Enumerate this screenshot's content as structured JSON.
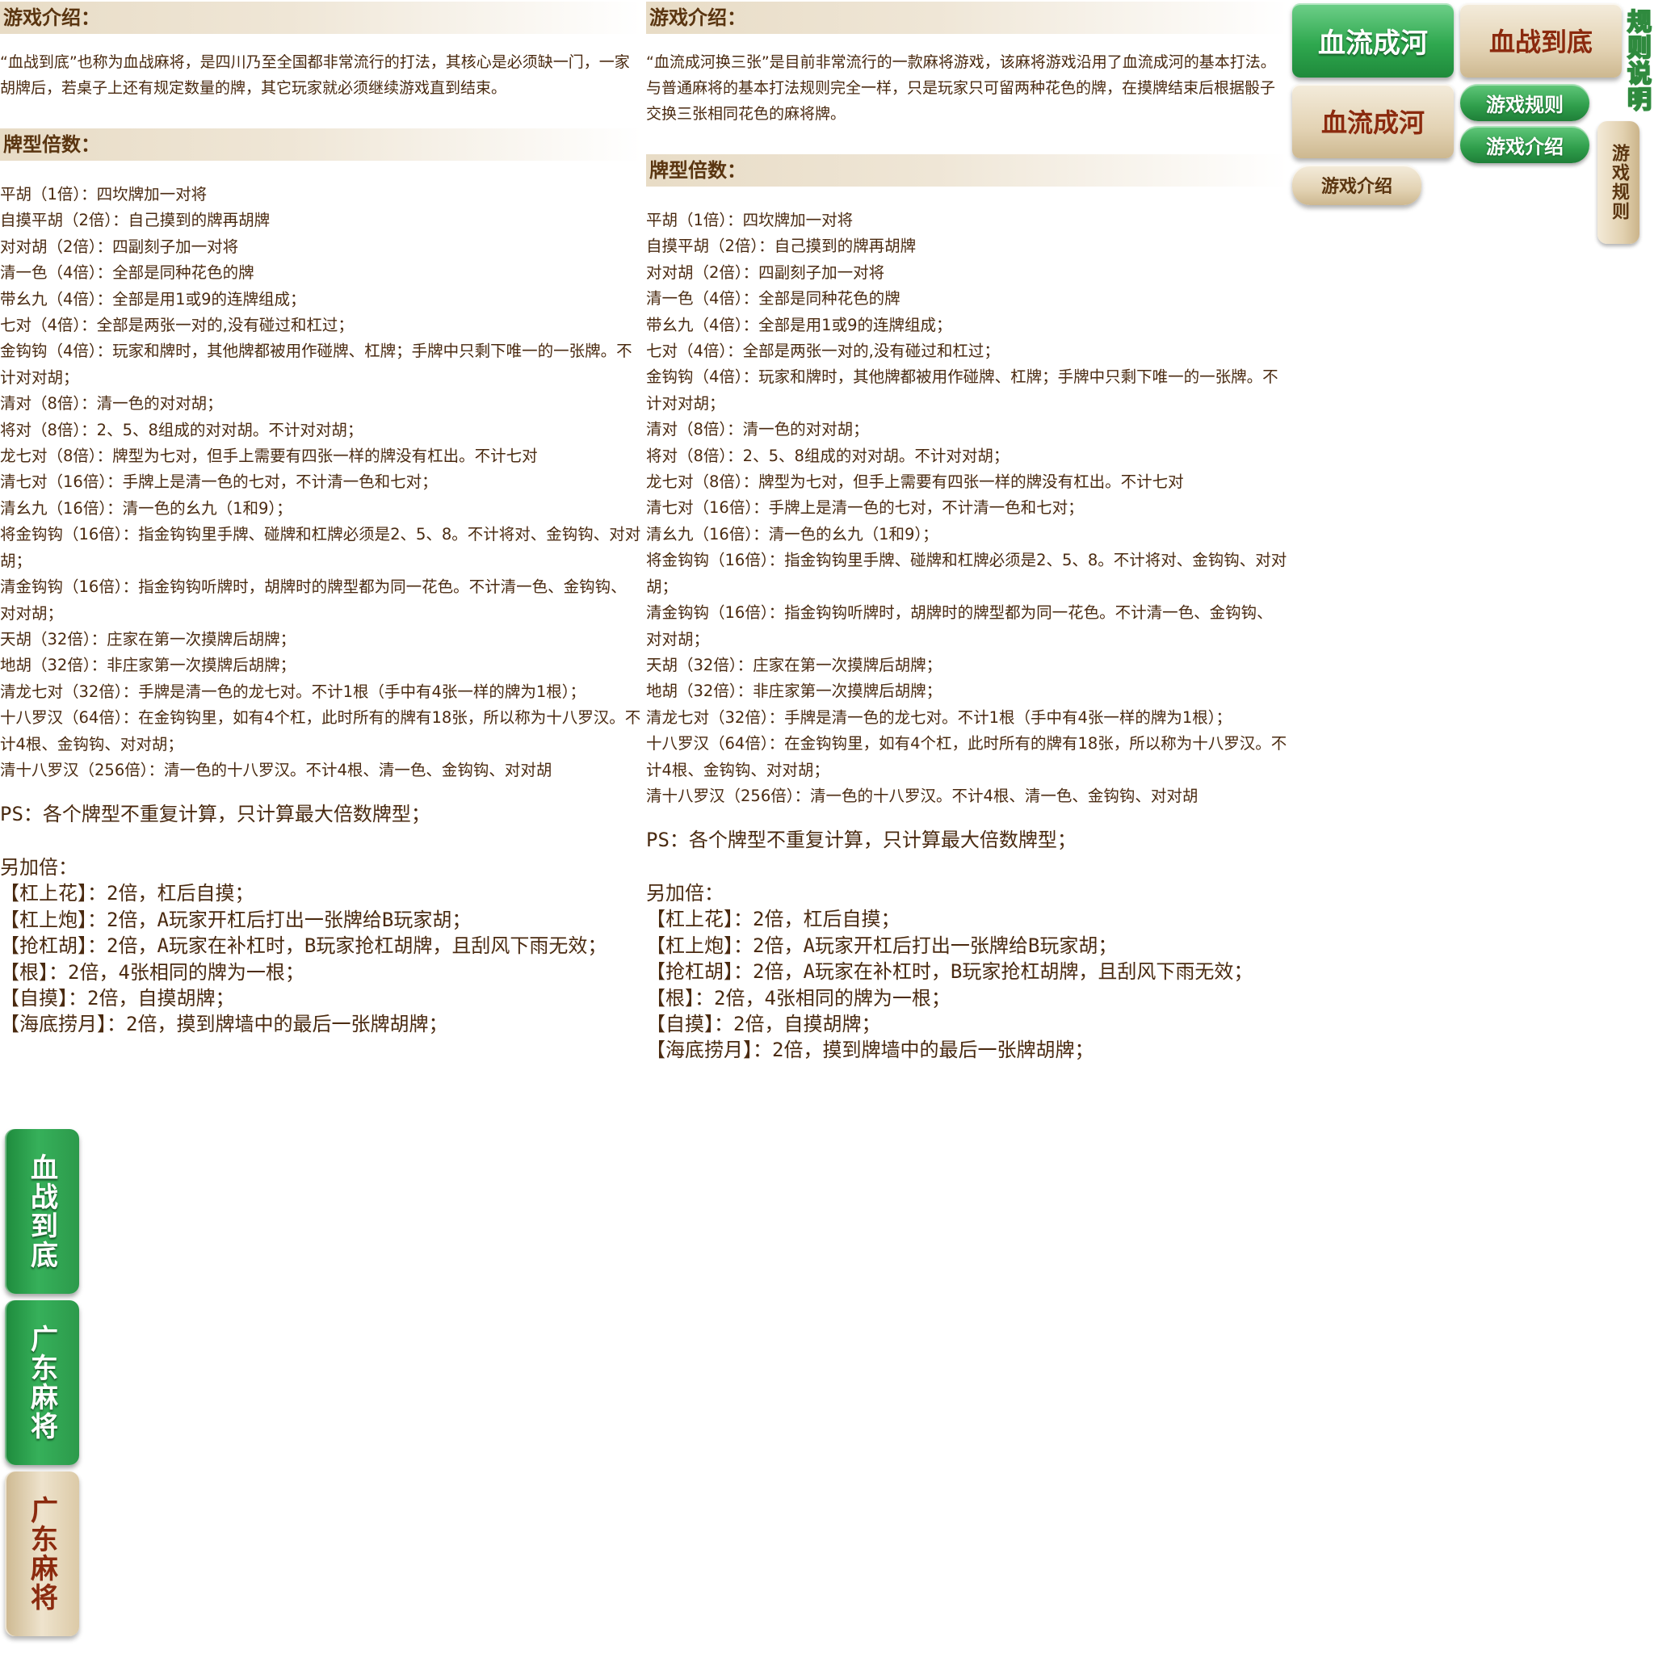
{
  "left_panel": {
    "intro_heading": "游戏介绍：",
    "intro_text": "“血战到底”也称为血战麻将，是四川乃至全国都非常流行的打法，其核心是必须缺一门，一家胡牌后，若桌子上还有规定数量的牌，其它玩家就必须继续游戏直到结束。",
    "types_heading": "牌型倍数：",
    "types": [
      "平胡（1倍）：四坎牌加一对将",
      "自摸平胡（2倍）：自己摸到的牌再胡牌",
      "对对胡（2倍）：四副刻子加一对将",
      "清一色（4倍）：全部是同种花色的牌",
      "带幺九（4倍）：全部是用1或9的连牌组成；",
      "七对（4倍）：全部是两张一对的,没有碰过和杠过；",
      "金钩钩（4倍）：玩家和牌时，其他牌都被用作碰牌、杠牌；手牌中只剩下唯一的一张牌。不计对对胡；",
      "清对（8倍）：清一色的对对胡；",
      "将对（8倍）：2、5、8组成的对对胡。不计对对胡；",
      "龙七对（8倍）：牌型为七对，但手上需要有四张一样的牌没有杠出。不计七对",
      "清七对（16倍）：手牌上是清一色的七对，不计清一色和七对；",
      "清幺九（16倍）：清一色的幺九（1和9）；",
      "将金钩钩（16倍）：指金钩钩里手牌、碰牌和杠牌必须是2、5、8。不计将对、金钩钩、对对胡；",
      "清金钩钩（16倍）：指金钩钩听牌时，胡牌时的牌型都为同一花色。不计清一色、金钩钩、对对胡；",
      "天胡（32倍）：庄家在第一次摸牌后胡牌；",
      "地胡（32倍）：非庄家第一次摸牌后胡牌；",
      "清龙七对（32倍）：手牌是清一色的龙七对。不计1根（手中有4张一样的牌为1根）；",
      "十八罗汉（64倍）：在金钩钩里，如有4个杠，此时所有的牌有18张，所以称为十八罗汉。不计4根、金钩钩、对对胡；",
      "清十八罗汉（256倍）：清一色的十八罗汉。不计4根、清一色、金钩钩、对对胡"
    ],
    "ps": "PS：各个牌型不重复计算，只计算最大倍数牌型；",
    "extra_heading": "另加倍：",
    "extras": [
      "【杠上花】：2倍，杠后自摸；",
      "【杠上炮】：2倍，A玩家开杠后打出一张牌给B玩家胡；",
      "【抢杠胡】：2倍，A玩家在补杠时，B玩家抢杠胡牌，且刮风下雨无效；",
      "【根】：2倍，4张相同的牌为一根；",
      "【自摸】：2倍，自摸胡牌；",
      "【海底捞月】：2倍，摸到牌墙中的最后一张牌胡牌；"
    ]
  },
  "right_panel": {
    "intro_heading": "游戏介绍：",
    "intro_text": "“血流成河换三张”是目前非常流行的一款麻将游戏，该麻将游戏沿用了血流成河的基本打法。与普通麻将的基本打法规则完全一样，只是玩家只可留两种花色的牌，在摸牌结束后根据骰子交换三张相同花色的麻将牌。",
    "types_heading": "牌型倍数：",
    "types": [
      "平胡（1倍）：四坎牌加一对将",
      "自摸平胡（2倍）：自己摸到的牌再胡牌",
      "对对胡（2倍）：四副刻子加一对将",
      "清一色（4倍）：全部是同种花色的牌",
      "带幺九（4倍）：全部是用1或9的连牌组成；",
      "七对（4倍）：全部是两张一对的,没有碰过和杠过；",
      "金钩钩（4倍）：玩家和牌时，其他牌都被用作碰牌、杠牌；手牌中只剩下唯一的一张牌。不计对对胡；",
      "清对（8倍）：清一色的对对胡；",
      "将对（8倍）：2、5、8组成的对对胡。不计对对胡；",
      "龙七对（8倍）：牌型为七对，但手上需要有四张一样的牌没有杠出。不计七对",
      "清七对（16倍）：手牌上是清一色的七对，不计清一色和七对；",
      "清幺九（16倍）：清一色的幺九（1和9）；",
      "将金钩钩（16倍）：指金钩钩里手牌、碰牌和杠牌必须是2、5、8。不计将对、金钩钩、对对胡；",
      "清金钩钩（16倍）：指金钩钩听牌时，胡牌时的牌型都为同一花色。不计清一色、金钩钩、对对胡；",
      "天胡（32倍）：庄家在第一次摸牌后胡牌；",
      "地胡（32倍）：非庄家第一次摸牌后胡牌；",
      "清龙七对（32倍）：手牌是清一色的龙七对。不计1根（手中有4张一样的牌为1根）；",
      "十八罗汉（64倍）：在金钩钩里，如有4个杠，此时所有的牌有18张，所以称为十八罗汉。不计4根、金钩钩、对对胡；",
      "清十八罗汉（256倍）：清一色的十八罗汉。不计4根、清一色、金钩钩、对对胡"
    ],
    "ps": "PS：各个牌型不重复计算，只计算最大倍数牌型；",
    "extra_heading": "另加倍：",
    "extras": [
      "【杠上花】：2倍，杠后自摸；",
      "【杠上炮】：2倍，A玩家开杠后打出一张牌给B玩家胡；",
      "【抢杠胡】：2倍，A玩家在补杠时，B玩家抢杠胡牌，且刮风下雨无效；",
      "【根】：2倍，4张相同的牌为一根；",
      "【自摸】：2倍，自摸胡牌；",
      "【海底捞月】：2倍，摸到牌墙中的最后一张牌胡牌；"
    ]
  },
  "buttons": {
    "xueliu_active": "血流成河",
    "xuezhan": "血战到底",
    "xueliu": "血流成河",
    "intro_beige": "游戏介绍",
    "rules_green": "游戏规则",
    "intro_green": "游戏介绍",
    "rules_vertical": "游戏规则",
    "title_vertical": "规则说明"
  },
  "side_tabs": {
    "xuezhan": "血战到底",
    "guangdong_active": "广东麻将",
    "guangdong": "广东麻将"
  },
  "colors": {
    "accent_green": "#2fa84f",
    "beige": "#e3d3b4",
    "text_brown": "#4a2a10",
    "label_red": "#8b2a0e"
  }
}
